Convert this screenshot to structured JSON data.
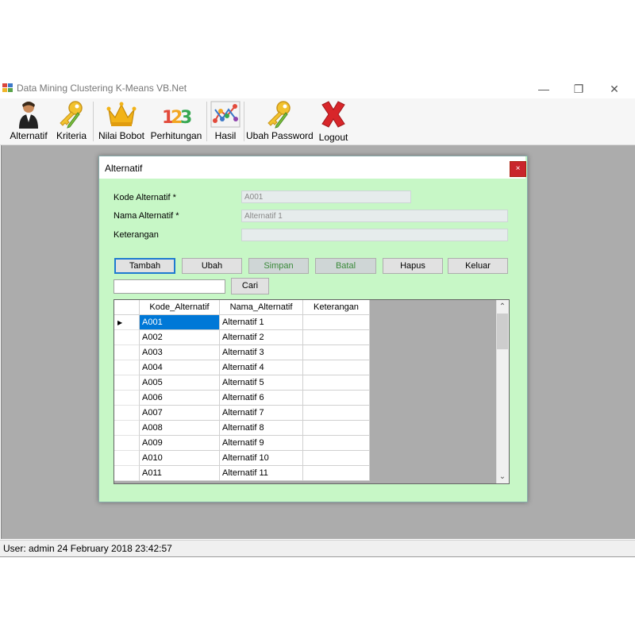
{
  "window": {
    "title": "Data Mining Clustering K-Means VB.Net",
    "controls": {
      "minimize": "—",
      "maximize": "❐",
      "close": "✕"
    }
  },
  "toolbar": {
    "items": [
      {
        "label": "Alternatif",
        "icon": "person-icon"
      },
      {
        "label": "Kriteria",
        "icon": "key-pencil-icon"
      },
      {
        "label": "Nilai Bobot",
        "icon": "crown-icon"
      },
      {
        "label": "Perhitungan",
        "icon": "numbers-123-icon"
      },
      {
        "label": "Hasil",
        "icon": "network-chart-icon"
      },
      {
        "label": "Ubah Password",
        "icon": "key-pencil-icon"
      },
      {
        "label": "Logout",
        "icon": "red-x-icon"
      }
    ]
  },
  "dialog": {
    "title": "Alternatif",
    "close_glyph": "×",
    "fields": {
      "kode_label": "Kode Alternatif *",
      "kode_value": "A001",
      "nama_label": "Nama Alternatif *",
      "nama_value": "Alternatif 1",
      "keterangan_label": "Keterangan",
      "keterangan_value": ""
    },
    "buttons": {
      "tambah": "Tambah",
      "ubah": "Ubah",
      "simpan": "Simpan",
      "batal": "Batal",
      "hapus": "Hapus",
      "keluar": "Keluar",
      "cari": "Cari"
    },
    "grid": {
      "columns": [
        "Kode_Alternatif",
        "Nama_Alternatif",
        "Keterangan"
      ],
      "rows": [
        [
          "A001",
          "Alternatif 1",
          ""
        ],
        [
          "A002",
          "Alternatif 2",
          ""
        ],
        [
          "A003",
          "Alternatif 3",
          ""
        ],
        [
          "A004",
          "Alternatif 4",
          ""
        ],
        [
          "A005",
          "Alternatif 5",
          ""
        ],
        [
          "A006",
          "Alternatif 6",
          ""
        ],
        [
          "A007",
          "Alternatif 7",
          ""
        ],
        [
          "A008",
          "Alternatif 8",
          ""
        ],
        [
          "A009",
          "Alternatif 9",
          ""
        ],
        [
          "A010",
          "Alternatif 10",
          ""
        ],
        [
          "A011",
          "Alternatif 11",
          ""
        ]
      ],
      "current_row_marker": "▶",
      "scroll_up": "⌃",
      "scroll_down": "⌄"
    }
  },
  "status": {
    "text": "User: admin  24 February 2018 23:42:57"
  },
  "colors": {
    "dialog_bg": "#c7f7c6",
    "workspace_bg": "#acacac",
    "selection": "#0078d7",
    "close_red": "#c9262c"
  }
}
